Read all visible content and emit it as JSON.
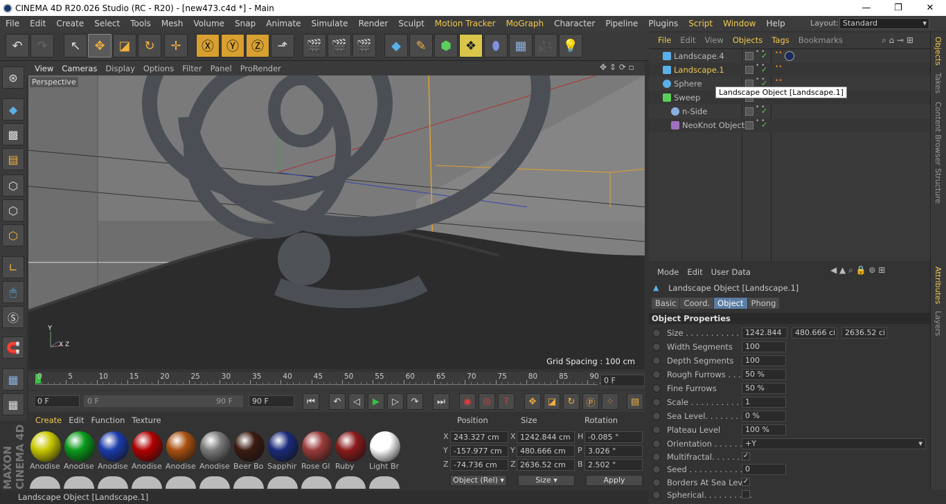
{
  "window": {
    "title": "CINEMA 4D R20.026 Studio (RC - R20) - [new473.c4d *] - Main",
    "min": "—",
    "max": "❐",
    "close": "✕"
  },
  "menu": [
    {
      "label": "File"
    },
    {
      "label": "Edit"
    },
    {
      "label": "Create"
    },
    {
      "label": "Select"
    },
    {
      "label": "Tools"
    },
    {
      "label": "Mesh"
    },
    {
      "label": "Volume"
    },
    {
      "label": "Snap"
    },
    {
      "label": "Animate"
    },
    {
      "label": "Simulate"
    },
    {
      "label": "Render"
    },
    {
      "label": "Sculpt"
    },
    {
      "label": "Motion Tracker",
      "hl": true
    },
    {
      "label": "MoGraph",
      "hl": true
    },
    {
      "label": "Character"
    },
    {
      "label": "Pipeline"
    },
    {
      "label": "Plugins"
    },
    {
      "label": "Script",
      "hl": true
    },
    {
      "label": "Window",
      "hl": true
    },
    {
      "label": "Help"
    }
  ],
  "layout": {
    "label": "Layout:",
    "value": "Standard"
  },
  "viewport": {
    "menu": [
      "View",
      "Cameras",
      "Display",
      "Options",
      "Filter",
      "Panel",
      "ProRender"
    ],
    "label": "Perspective",
    "grid_spacing": "Grid Spacing : 100 cm",
    "axis_y": "Y",
    "axis_xz": "X Z"
  },
  "timeline": {
    "ticks": [
      "0",
      "5",
      "10",
      "15",
      "20",
      "25",
      "30",
      "35",
      "40",
      "45",
      "50",
      "55",
      "60",
      "65",
      "70",
      "75",
      "80",
      "85",
      "90"
    ],
    "current": "0 F"
  },
  "transport": {
    "start": "0 F",
    "range_start": "0 F",
    "range_end": "90 F",
    "end": "90 F"
  },
  "materials": {
    "menu": [
      "Create",
      "Edit",
      "Function",
      "Texture"
    ],
    "items": [
      {
        "name": "Anodise",
        "color": "#c8c800"
      },
      {
        "name": "Anodise",
        "color": "#0a9a1a"
      },
      {
        "name": "Anodise",
        "color": "#1a3aa8"
      },
      {
        "name": "Anodise",
        "color": "#b00000"
      },
      {
        "name": "Anodise",
        "color": "#a85010"
      },
      {
        "name": "Anodise",
        "color": "#7a7a7a"
      },
      {
        "name": "Beer Bo",
        "color": "#3a1a10"
      },
      {
        "name": "Sapphir",
        "color": "#1a2a7a"
      },
      {
        "name": "Rose Gl",
        "color": "#9a3a3a"
      },
      {
        "name": "Ruby",
        "color": "#8a1a1a"
      },
      {
        "name": "Light Br",
        "color": "#ffffff"
      }
    ]
  },
  "coords": {
    "headers": [
      "Position",
      "Size",
      "Rotation"
    ],
    "rows": [
      {
        "axis": "X",
        "pos": "243.327 cm",
        "size_axis": "X",
        "size": "1242.844 cm",
        "rot_axis": "H",
        "rot": "-0.085 °"
      },
      {
        "axis": "Y",
        "pos": "-157.977 cm",
        "size_axis": "Y",
        "size": "480.666 cm",
        "rot_axis": "P",
        "rot": "3.026 °"
      },
      {
        "axis": "Z",
        "pos": "-74.736 cm",
        "size_axis": "Z",
        "size": "2636.52 cm",
        "rot_axis": "B",
        "rot": "2.502 °"
      }
    ],
    "mode": "Object (Rel)",
    "size_mode": "Size",
    "apply": "Apply"
  },
  "status": "Landscape Object [Landscape.1]",
  "objects": {
    "menu": [
      "File",
      "Edit",
      "View",
      "Objects",
      "Tags",
      "Bookmarks"
    ],
    "hl_menu": [
      0,
      3,
      4
    ],
    "items": [
      {
        "name": "Landscape.4",
        "hl": false
      },
      {
        "name": "Landscape.1",
        "hl": true
      },
      {
        "name": "Sphere",
        "hl": false
      },
      {
        "name": "Sweep",
        "hl": false
      },
      {
        "name": "n-Side",
        "hl": false
      },
      {
        "name": "NeoKnot Object",
        "hl": false
      }
    ]
  },
  "tooltip": "Landscape Object [Landscape.1]",
  "attributes": {
    "menu": [
      "Mode",
      "Edit",
      "User Data"
    ],
    "title": "Landscape Object [Landscape.1]",
    "tabs": [
      "Basic",
      "Coord.",
      "Object",
      "Phong"
    ],
    "section": "Object Properties",
    "size": [
      "1242.844",
      "480.666 ci",
      "2636.52 ci"
    ],
    "props": [
      {
        "label": "Width Segments",
        "value": "100"
      },
      {
        "label": "Depth Segments",
        "value": "100"
      },
      {
        "label": "Rough Furrows . . . .",
        "value": "50 %"
      },
      {
        "label": "Fine Furrows",
        "value": "50 %"
      },
      {
        "label": "Scale . . . . . . . . . . . .",
        "value": "1"
      },
      {
        "label": "Sea Level. . . . . . . .",
        "value": "0 %"
      },
      {
        "label": "Plateau Level",
        "value": "100 %"
      }
    ],
    "size_label": "Size . . . . . . . . . . . . .",
    "orientation_label": "Orientation . . . . . .",
    "orientation": "+Y",
    "multifractal": "Multifractal. . . . . . . .",
    "seed_label": "Seed . . . . . . . . . . . . .",
    "seed": "0",
    "borders": "Borders At Sea Level",
    "spherical": "Spherical. . . . . . . . . ."
  },
  "sidetabs": [
    "Objects",
    "Takes",
    "Content Browser",
    "Structure",
    "Attributes",
    "Layers"
  ],
  "brand": "MAXON CINEMA 4D"
}
